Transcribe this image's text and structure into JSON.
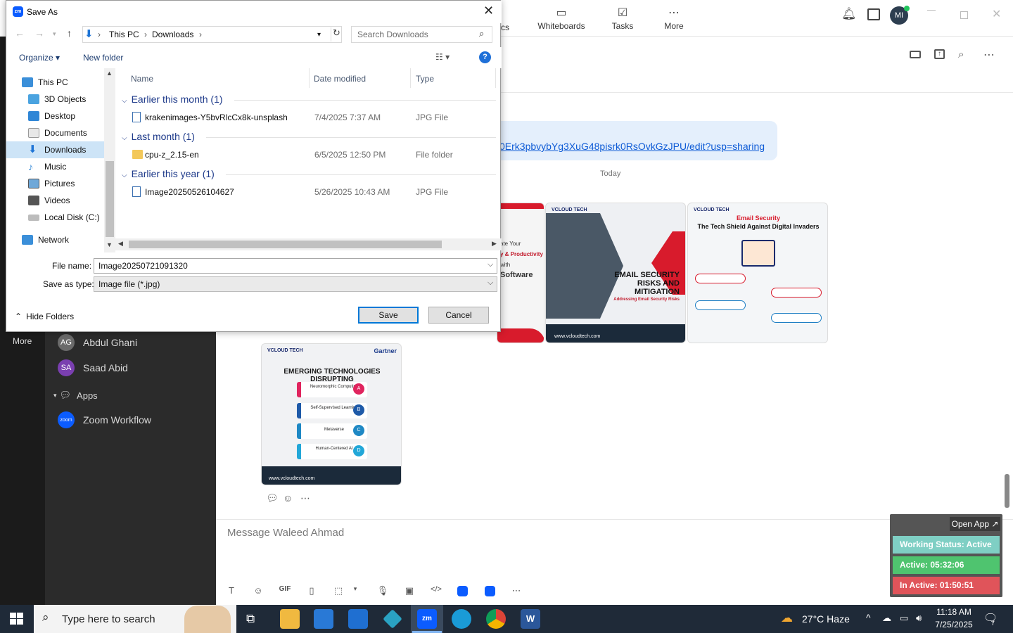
{
  "zoom": {
    "tabs": [
      {
        "label": "cs",
        "icon": "chart-icon"
      },
      {
        "label": "Whiteboards",
        "icon": "whiteboard-icon"
      },
      {
        "label": "Tasks",
        "icon": "tasks-icon"
      },
      {
        "label": "More",
        "icon": "more-dots-icon"
      }
    ],
    "avatar_initials": "MI",
    "rail_more": "More",
    "contacts": [
      {
        "name": "Abdul Ghani",
        "initials": "AG",
        "color": "#6b6b6b"
      },
      {
        "name": "Saad Abid",
        "initials": "SA",
        "color": "#7a3fb0"
      }
    ],
    "apps_section": "Apps",
    "app_item": "Zoom Workflow",
    "app_logo": "zoom",
    "link_text": "0Erk3pbvybYg3XuG48pisrk0RsOvkGzJPU/edit?usp=sharing",
    "today": "Today",
    "composer_placeholder": "Message Waleed Ahmad",
    "images": [
      {
        "brand": "VCLOUD TECH",
        "title_lines": "EMAIL SECURITY RISKS AND MITIGATION",
        "subtitle": "Addressing Email Security Risks",
        "site": "www.vcloudtech.com"
      },
      {
        "brand": "VCLOUD TECH",
        "title_top": "Email Security",
        "title_main": "The Tech Shield Against Digital Invaders"
      },
      {
        "brand": "VCLOUD TECH",
        "partner": "Gartner",
        "title": "EMERGING TECHNOLOGIES DISRUPTING",
        "items": [
          "Neuromorphic Computing",
          "Self-Supervised Learning",
          "Metaverse",
          "Human-Centered AI"
        ],
        "letters": [
          "A",
          "B",
          "C",
          "D"
        ],
        "site": "www.vcloudtech.com"
      },
      {
        "brand": "VCLOUD TECH",
        "lines": [
          "ate Your",
          "y & Productivity",
          "with",
          "Software"
        ]
      }
    ],
    "widget": {
      "open_app": "Open App ↗",
      "status": "Working Status: Active",
      "active": "Active: 05:32:06",
      "inactive": "In Active: 01:50:51"
    }
  },
  "dialog": {
    "title": "Save As",
    "address": {
      "root": "This PC",
      "folder": "Downloads"
    },
    "search_placeholder": "Search Downloads",
    "organize": "Organize ▾",
    "new_folder": "New folder",
    "tree": [
      {
        "label": "This PC",
        "icon": "pc-icon"
      },
      {
        "label": "3D Objects",
        "icon": "cube-icon"
      },
      {
        "label": "Desktop",
        "icon": "desktop-icon"
      },
      {
        "label": "Documents",
        "icon": "documents-icon"
      },
      {
        "label": "Downloads",
        "icon": "download-arrow-icon"
      },
      {
        "label": "Music",
        "icon": "music-icon"
      },
      {
        "label": "Pictures",
        "icon": "pictures-icon"
      },
      {
        "label": "Videos",
        "icon": "videos-icon"
      },
      {
        "label": "Local Disk (C:)",
        "icon": "disk-icon"
      },
      {
        "label": "Network",
        "icon": "network-icon"
      }
    ],
    "columns": {
      "name": "Name",
      "date": "Date modified",
      "type": "Type"
    },
    "groups": [
      {
        "label": "Earlier this month (1)",
        "file": {
          "name": "krakenimages-Y5bvRlcCx8k-unsplash",
          "date": "7/4/2025 7:37 AM",
          "type": "JPG File"
        }
      },
      {
        "label": "Last month (1)",
        "file": {
          "name": "cpu-z_2.15-en",
          "date": "6/5/2025 12:50 PM",
          "type": "File folder"
        }
      },
      {
        "label": "Earlier this year (1)",
        "file": {
          "name": "Image20250526104627",
          "date": "5/26/2025 10:43 AM",
          "type": "JPG File"
        }
      }
    ],
    "file_name_label": "File name:",
    "file_name_value": "Image20250721091320",
    "save_type_label": "Save as type:",
    "save_type_value": "Image file (*.jpg)",
    "hide_folders": "Hide Folders",
    "save": "Save",
    "cancel": "Cancel"
  },
  "taskbar": {
    "search_placeholder": "Type here to search",
    "weather": "27°C  Haze",
    "time": "11:18 AM",
    "date": "7/25/2025",
    "notif_count": "7"
  }
}
